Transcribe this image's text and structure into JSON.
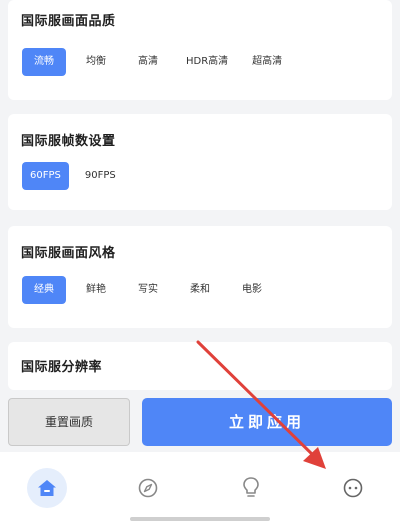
{
  "sections": {
    "quality": {
      "title": "国际服画面品质",
      "options": [
        "流畅",
        "均衡",
        "高清",
        "HDR高清",
        "超高清"
      ],
      "selected": "流畅"
    },
    "fps": {
      "title": "国际服帧数设置",
      "options": [
        "60FPS",
        "90FPS"
      ],
      "selected": "60FPS"
    },
    "style": {
      "title": "国际服画面风格",
      "options": [
        "经典",
        "鲜艳",
        "写实",
        "柔和",
        "电影"
      ],
      "selected": "经典"
    },
    "resolution": {
      "title": "国际服分辨率"
    }
  },
  "actions": {
    "reset_label": "重置画质",
    "apply_label": "立即应用"
  },
  "tabbar": {
    "tabs": [
      {
        "icon": "home-icon",
        "active": true
      },
      {
        "icon": "compass-icon",
        "active": false
      },
      {
        "icon": "lightbulb-icon",
        "active": false
      },
      {
        "icon": "more-icon",
        "active": false
      }
    ]
  },
  "colors": {
    "accent": "#4f86f7",
    "annotation_arrow": "#e0413a"
  }
}
